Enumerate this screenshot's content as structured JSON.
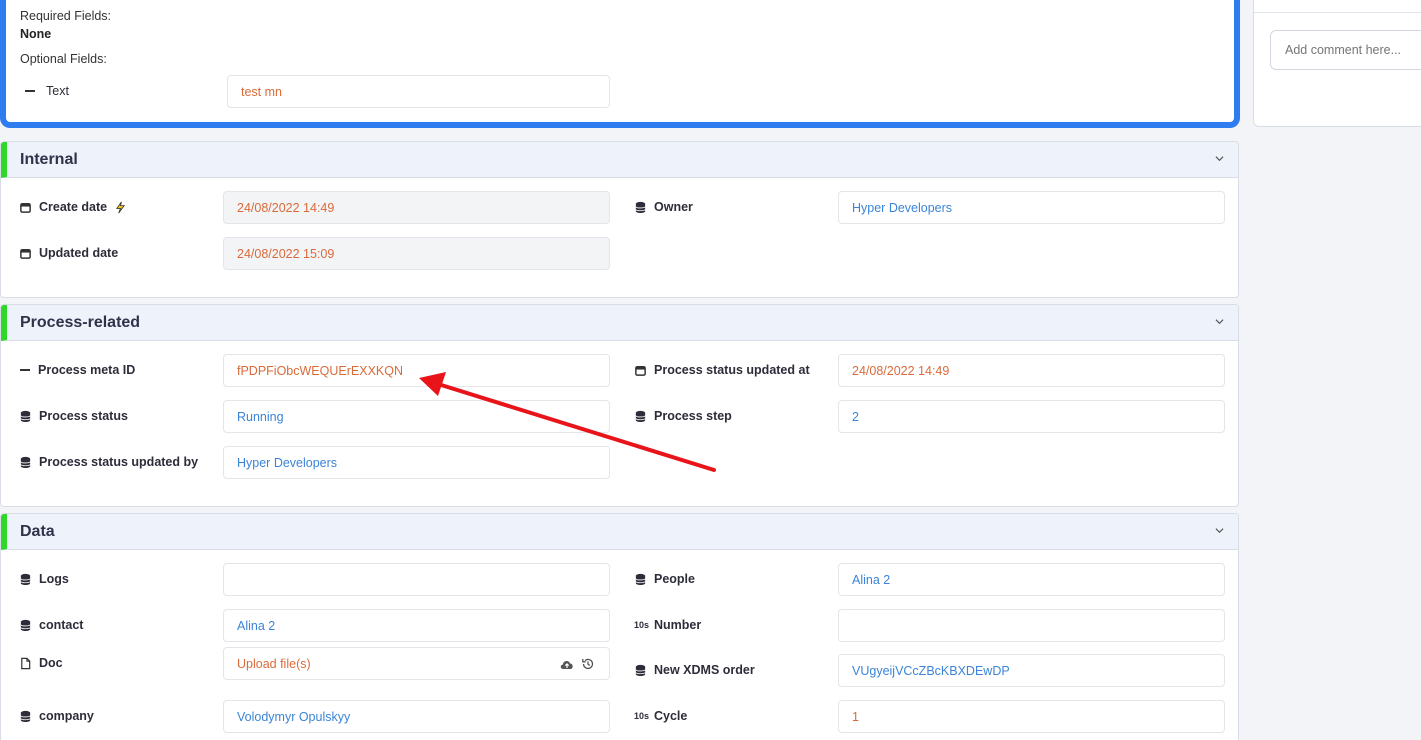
{
  "top": {
    "required_label": "Required Fields:",
    "required_value": "None",
    "optional_label": "Optional Fields:",
    "text_label": "Text",
    "text_value": "test mn"
  },
  "sidebar": {
    "comment_placeholder": "Add comment here..."
  },
  "sections": {
    "internal": {
      "title": "Internal",
      "create_date_label": "Create date",
      "create_date_value": "24/08/2022 14:49",
      "updated_date_label": "Updated date",
      "updated_date_value": "24/08/2022 15:09",
      "owner_label": "Owner",
      "owner_value": "Hyper Developers"
    },
    "process": {
      "title": "Process-related",
      "meta_id_label": "Process meta ID",
      "meta_id_value": "fPDPFiObcWEQUErEXXKQN",
      "status_updated_at_label": "Process status updated at",
      "status_updated_at_value": "24/08/2022 14:49",
      "status_label": "Process status",
      "status_value": "Running",
      "step_label": "Process step",
      "step_value": "2",
      "status_updated_by_label": "Process status updated by",
      "status_updated_by_value": "Hyper Developers"
    },
    "data": {
      "title": "Data",
      "logs_label": "Logs",
      "logs_value": "",
      "people_label": "People",
      "people_value": "Alina 2",
      "contact_label": "contact",
      "contact_value": "Alina 2",
      "number_label": "Number",
      "number_value": "",
      "number_icon_text": "10s",
      "doc_label": "Doc",
      "doc_value": "Upload file(s)",
      "xdms_label": "New XDMS order",
      "xdms_value": "VUgyeijVCcZBcKBXDEwDP",
      "company_label": "company",
      "company_value": "Volodymyr Opulskyy",
      "cycle_label": "Cycle",
      "cycle_value": "1",
      "cycle_icon_text": "10s"
    }
  },
  "colors": {
    "accent": "#2f7cf0",
    "section_marker": "#2ed82b",
    "value_orange": "#d96b3a",
    "value_blue": "#3b84d8",
    "annotation_arrow": "#e8141a"
  }
}
